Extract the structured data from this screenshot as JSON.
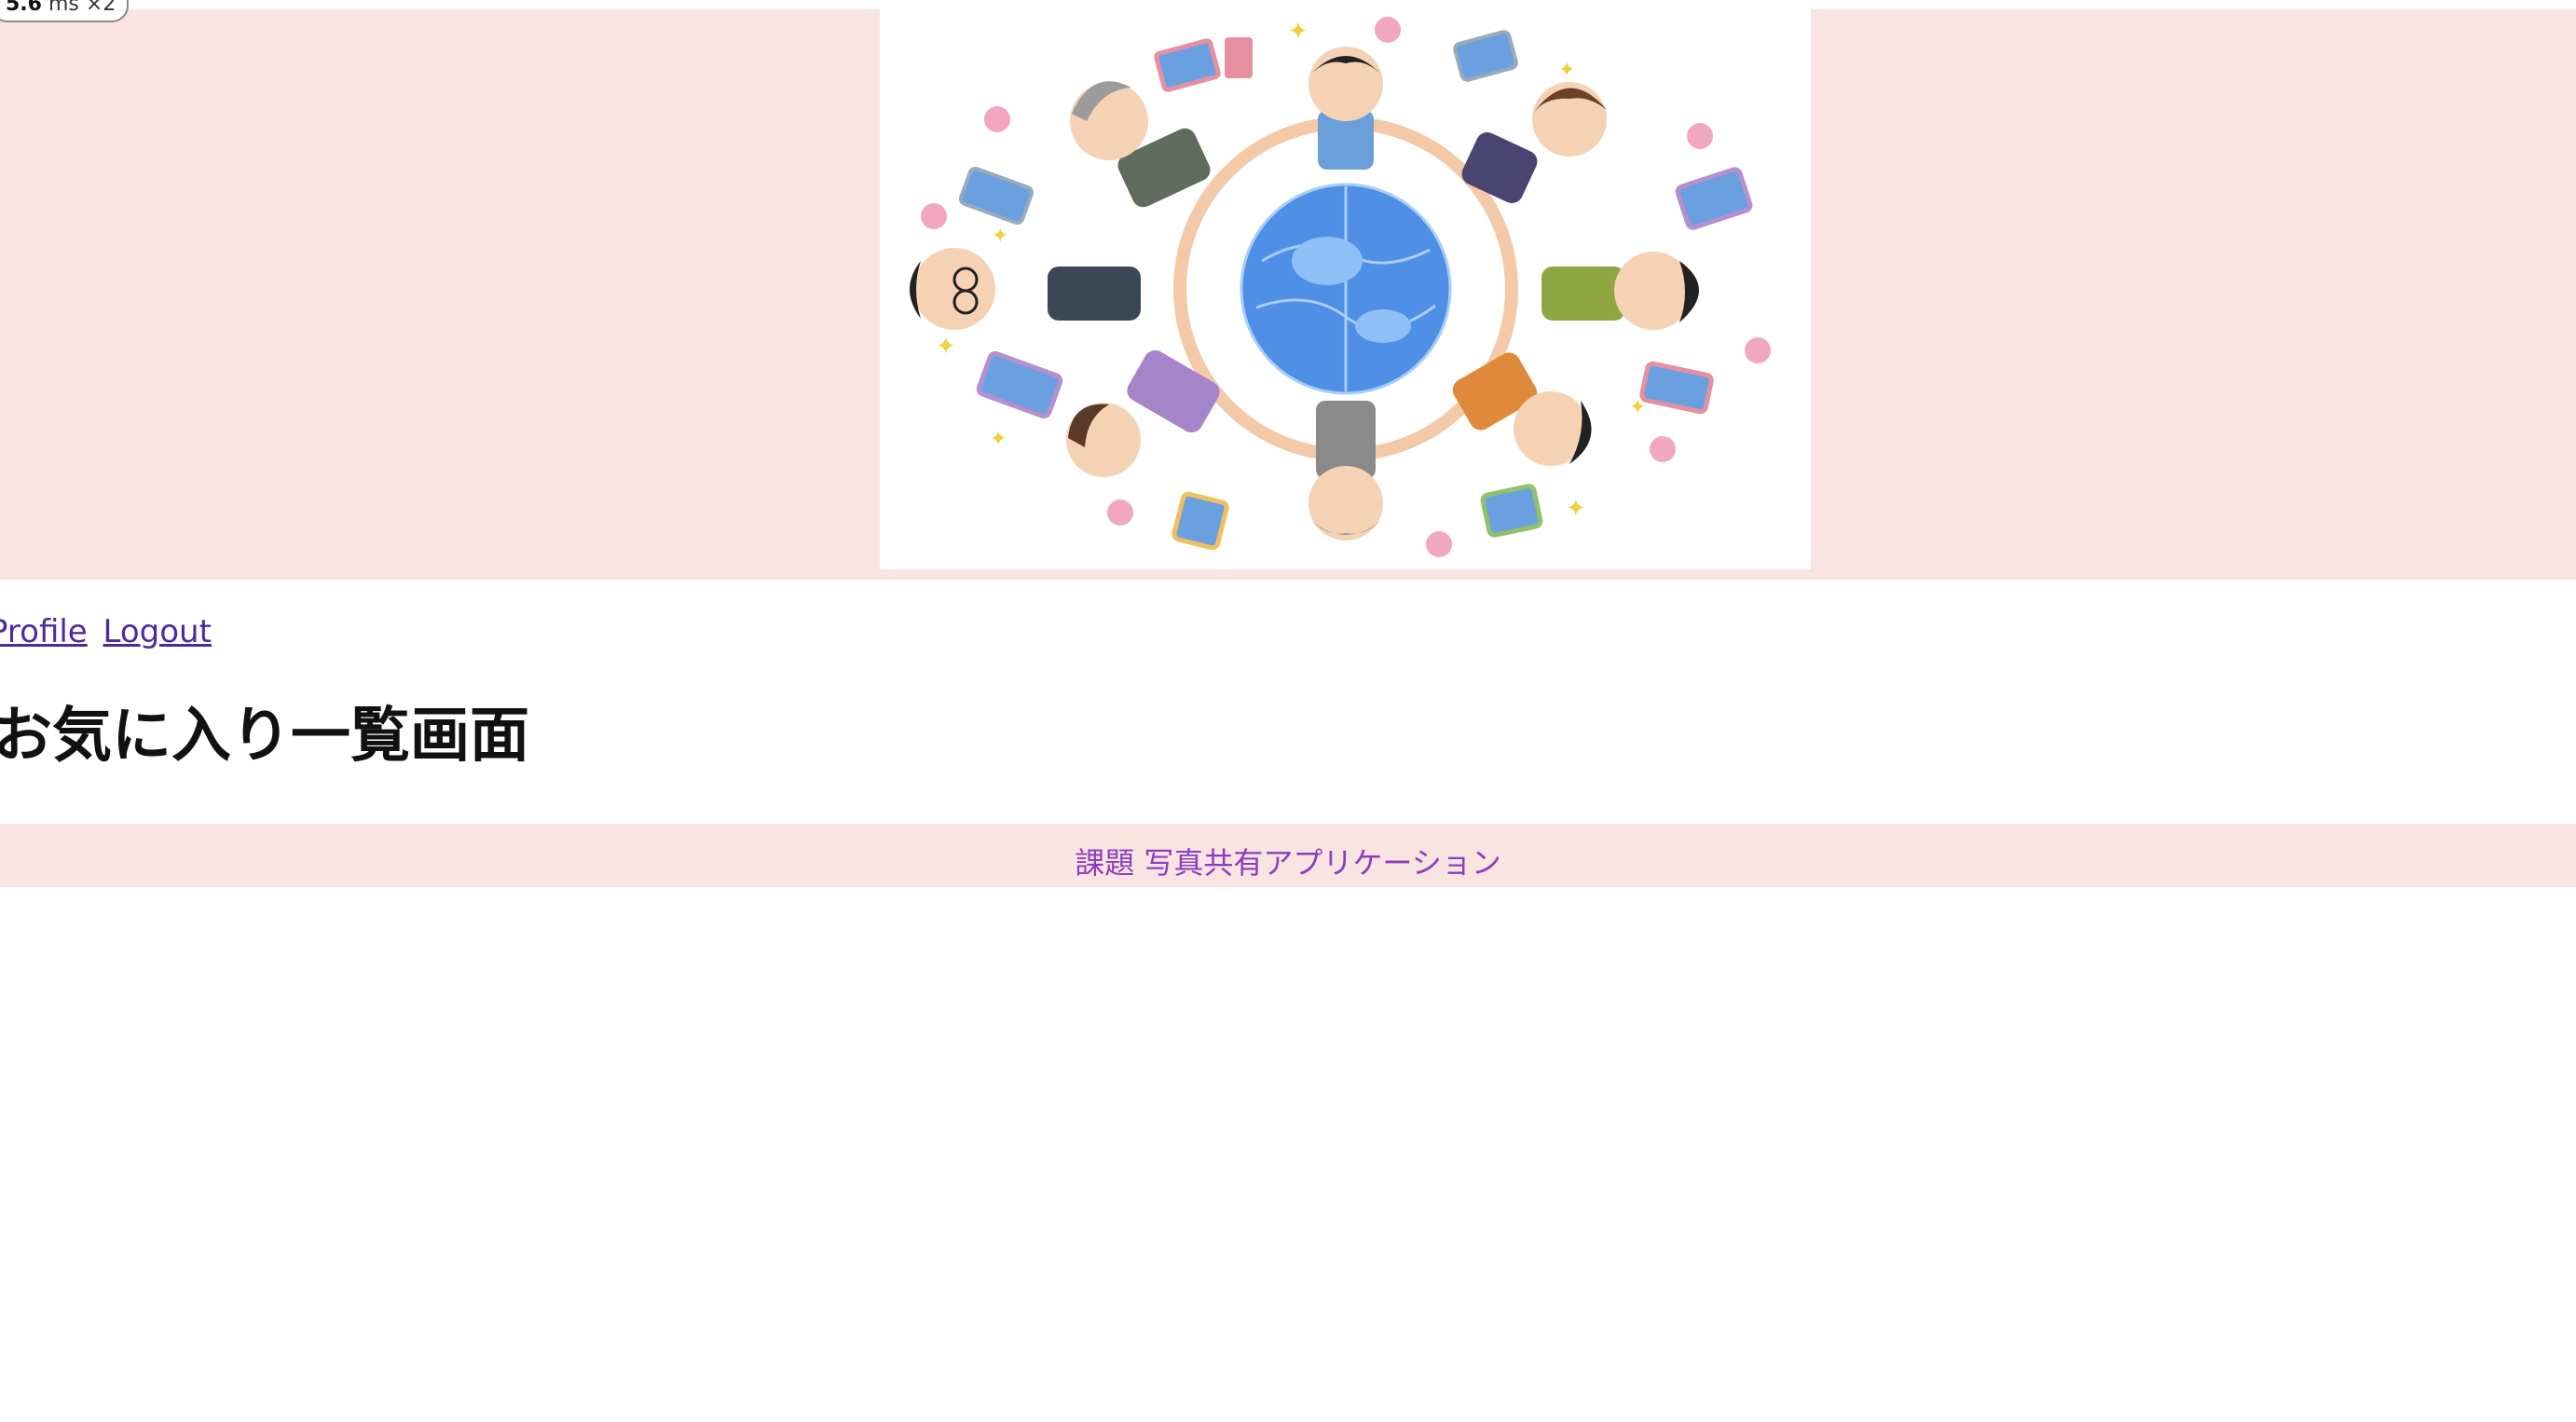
{
  "debug_badge": {
    "value": "5.6",
    "unit": "ms",
    "multiplier": "×2"
  },
  "header": {
    "hero_image": {
      "description_icon": "people-holding-hands-around-globe-illustration",
      "colors": {
        "background": "#f9e4e2",
        "globe": "#4f8fe6"
      }
    }
  },
  "nav": {
    "profile_label": "Profile",
    "logout_label": "Logout",
    "link_color": "#4f2a9e"
  },
  "main": {
    "title": "お気に入り一覧画面"
  },
  "footer": {
    "text": "課題 写真共有アプリケーション",
    "color": "#8a3fbf"
  }
}
